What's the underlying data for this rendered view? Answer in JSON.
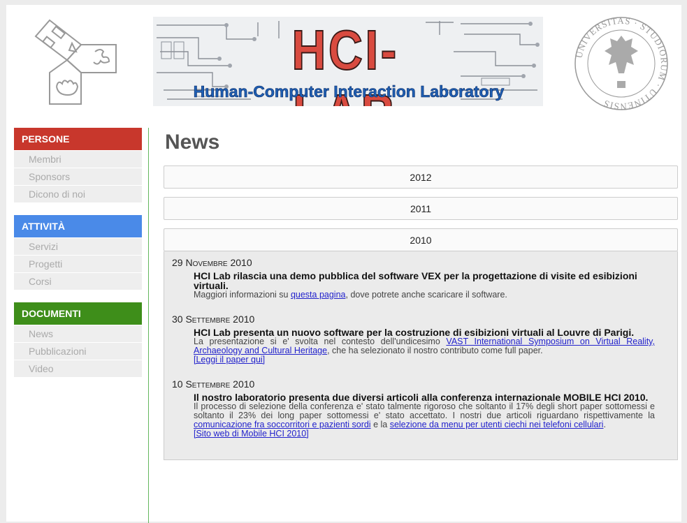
{
  "header": {
    "banner_title": "HCI-LAB",
    "banner_subtitle": "Human-Computer Interaction Laboratory",
    "seal_text": "UNIVERSITAS · STUDIORUM · UTINENSIS"
  },
  "sidebar": {
    "sections": [
      {
        "title": "PERSONE",
        "color": "#c8372c",
        "items": [
          "Membri",
          "Sponsors",
          "Dicono di noi"
        ]
      },
      {
        "title": "ATTIVITÀ",
        "color": "#4a8ae8",
        "items": [
          "Servizi",
          "Progetti",
          "Corsi"
        ]
      },
      {
        "title": "DOCUMENTI",
        "color": "#3e8e1a",
        "items": [
          "News",
          "Pubblicazioni",
          "Video"
        ]
      }
    ]
  },
  "main": {
    "title": "News",
    "years": [
      "2012",
      "2011",
      "2010"
    ],
    "news": [
      {
        "date_day": "29",
        "date_month": "Novembre",
        "date_year": "2010",
        "headline": "HCI Lab rilascia una demo pubblica del software VEX per la progettazione di visite ed esibizioni virtuali.",
        "body_pre": "Maggiori informazioni su ",
        "link1": "questa pagina",
        "body_post": ", dove potrete anche scaricare il software."
      },
      {
        "date_day": "30",
        "date_month": "Settembre",
        "date_year": "2010",
        "headline": "HCI Lab presenta un nuovo software per la costruzione di esibizioni virtuali al Louvre di Parigi.",
        "body_pre": "La presentazione si e' svolta nel contesto dell'undicesimo ",
        "link1": "VAST International Symposium on Virtual Reality, Archaeology and Cultural Heritage",
        "body_post": ", che ha selezionato il nostro contributo come full paper.",
        "link2": "[Leggi il paper qui]"
      },
      {
        "date_day": "10",
        "date_month": "Settembre",
        "date_year": "2010",
        "headline": "Il nostro laboratorio presenta due diversi articoli alla conferenza internazionale MOBILE HCI 2010.",
        "body_pre": "Il processo di selezione della conferenza e' stato talmente rigoroso che soltanto il 17% degli short paper sottomessi e soltanto il 23% dei long paper sottomessi e' stato accettato. I nostri due articoli riguardano rispettivamente la ",
        "link1": "comunicazione fra soccorritori e pazienti sordi",
        "body_mid": " e la ",
        "link_b": "selezione da menu per utenti ciechi nei telefoni cellulari",
        "body_post": ".",
        "link2": "[Sito web di Mobile HCI 2010]"
      }
    ]
  }
}
